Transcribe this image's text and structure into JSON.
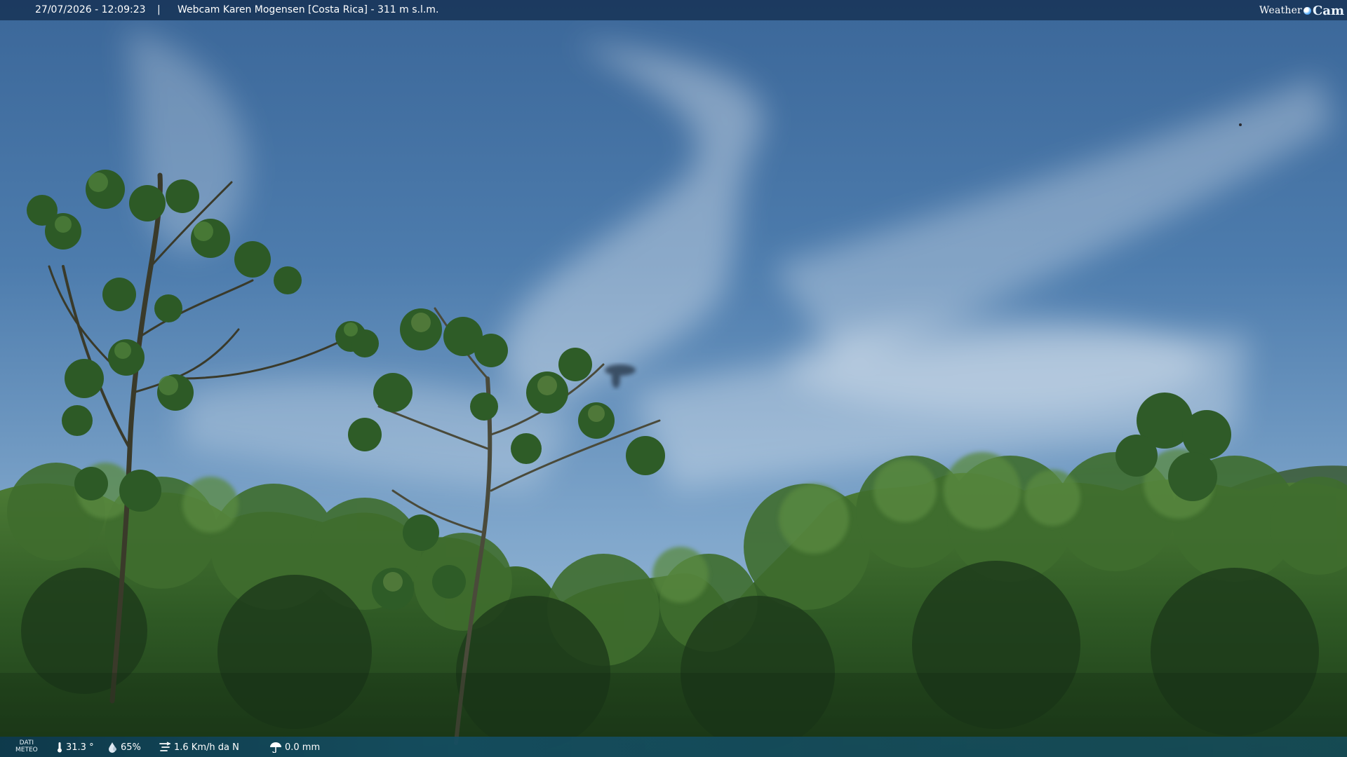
{
  "overlay": {
    "datetime": "27/07/2026 - 12:09:23",
    "separator": "|",
    "title": "Webcam Karen Mogensen [Costa Rica] - 311 m s.l.m.",
    "logo_part1": "Weather",
    "logo_part2": "Cam"
  },
  "weather": {
    "label_line1": "DATI",
    "label_line2": "METEO",
    "temperature": "31.3 °",
    "humidity": "65%",
    "wind": "1.6 Km/h da N",
    "rain": "0.0 mm"
  },
  "icons": {
    "temperature": "thermometer-icon",
    "humidity": "humidity-drop-icon",
    "wind": "wind-icon",
    "rain": "rain-icon",
    "logo": "weathercam-globe-icon"
  },
  "colors": {
    "sky_top": "#3c6a9c",
    "sky_bottom": "#8fb4d4",
    "foliage_dark": "#1f3f1c",
    "foliage_light": "#4a7a35",
    "bar": "#183458"
  }
}
